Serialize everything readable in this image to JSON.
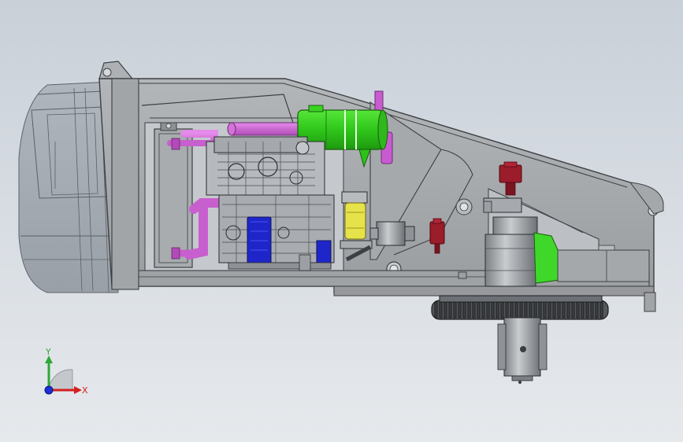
{
  "viewport": {
    "background_top": "#c9d0d8",
    "background_bottom": "#e6e9ec"
  },
  "triad": {
    "y_label": "Y",
    "x_label": "X",
    "y_color": "#2fa83a",
    "x_color": "#d42020",
    "z_color": "#1d2fd6"
  },
  "colors": {
    "frame": "#a9adb0",
    "frame_edge": "#3d3f42",
    "cab_glass": "#9fa7b0",
    "air_filter": "#39d31f",
    "intake_pipe": "#d266d8",
    "engine_block": "#b9bcc0",
    "oil_filter": "#e6e24a",
    "blue_part": "#1f26c9",
    "valve_red": "#9b1c2a",
    "green_plate": "#3fd82a",
    "slew_gear": "#55585b"
  },
  "parts": [
    "cab-shell",
    "main-frame",
    "radiator",
    "intake-pipe",
    "air-filter",
    "engine",
    "oil-filter",
    "hydraulic-pump",
    "slew-motor",
    "slew-ring-gear",
    "center-joint",
    "counterweight-box"
  ]
}
